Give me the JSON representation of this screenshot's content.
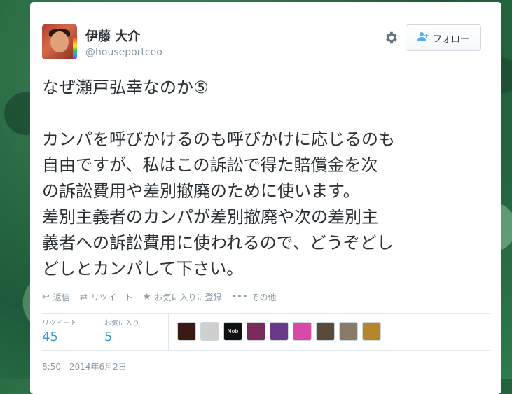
{
  "user": {
    "name": "伊藤 大介",
    "handle": "@houseportceo"
  },
  "follow_button": {
    "label": "フォロー"
  },
  "tweet": {
    "text": "なぜ瀬戸弘幸なのか⑤\n\nカンパを呼びかけるのも呼びかけに応じるのも\n自由ですが、私はこの訴訟で得た賠償金を次\nの訴訟費用や差別撤廃のために使います。\n差別主義者のカンパが差別撤廃や次の差別主\n義者への訴訟費用に使われるので、どうぞどし\nどしとカンパして下さい。"
  },
  "actions": {
    "reply": "返信",
    "retweet": "リツイート",
    "favorite": "お気に入りに登録",
    "more": "その他"
  },
  "stats": {
    "retweets_label": "リツイート",
    "retweets_value": "45",
    "favorites_label": "お気に入り",
    "favorites_value": "5"
  },
  "favoriters": [
    {
      "name": "user-1",
      "color": "#3a1a14"
    },
    {
      "name": "user-2",
      "color": "#cfcfcf"
    },
    {
      "name": "user-3",
      "color": "#111111",
      "text": "Nob"
    },
    {
      "name": "user-4",
      "color": "#7a2a5a"
    },
    {
      "name": "user-5",
      "color": "#6a3a8a"
    },
    {
      "name": "user-6",
      "color": "#d94aa8"
    },
    {
      "name": "user-7",
      "color": "#5a4a3a"
    },
    {
      "name": "user-8",
      "color": "#8a7a6a"
    },
    {
      "name": "user-9",
      "color": "#b8862a"
    }
  ],
  "timestamp": "8:50 - 2014年6月2日"
}
